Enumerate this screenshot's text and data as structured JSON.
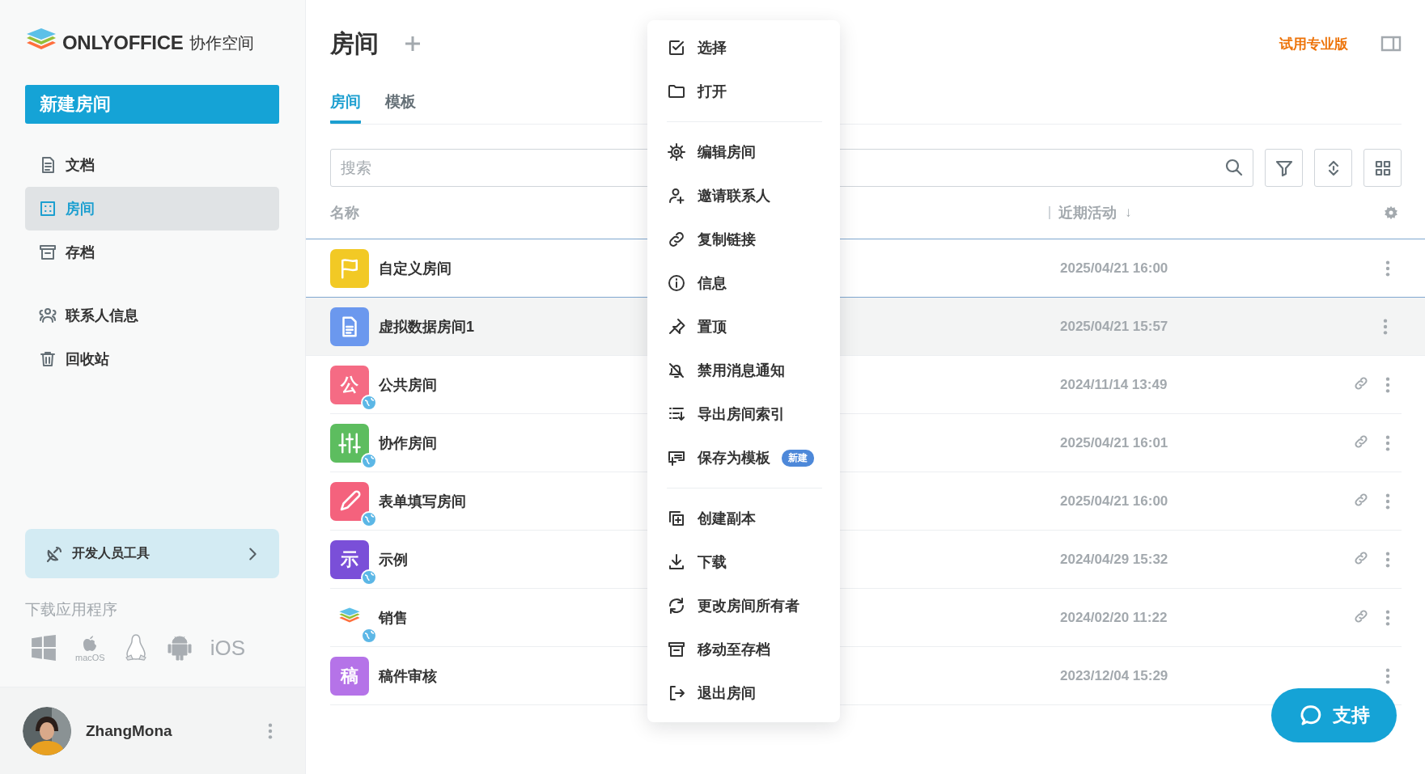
{
  "logo": {
    "brand": "ONLYOFFICE",
    "product": "协作空间"
  },
  "sidebar": {
    "new_button": "新建房间",
    "sections": [
      {
        "items": [
          {
            "label": "文档",
            "selected": false
          },
          {
            "label": "房间",
            "selected": true
          },
          {
            "label": "存档",
            "selected": false
          }
        ]
      },
      {
        "items": [
          {
            "label": "联系人信息",
            "selected": false
          },
          {
            "label": "回收站",
            "selected": false
          }
        ]
      }
    ],
    "dev_tools": "开发人员工具",
    "download_label": "下载应用程序",
    "apps": [
      {
        "kind": "windows"
      },
      {
        "kind": "macos",
        "label": "macOS"
      },
      {
        "kind": "linux"
      },
      {
        "kind": "android"
      },
      {
        "kind": "ios",
        "label": "iOS"
      }
    ],
    "user": {
      "name": "ZhangMona"
    }
  },
  "header": {
    "title": "房间",
    "trial": "试用专业版"
  },
  "tabs": [
    {
      "label": "房间",
      "selected": true
    },
    {
      "label": "模板",
      "selected": false
    }
  ],
  "search": {
    "placeholder": "搜索"
  },
  "table": {
    "columns": [
      {
        "label": "名称"
      },
      {
        "label": "近期活动",
        "sort": "↓"
      }
    ],
    "rows": [
      {
        "name": "自定义房间",
        "date": "2025/04/21 16:00",
        "icon": {
          "kind": "flag",
          "color": "#f2c925"
        },
        "public": false,
        "link": false,
        "selected": false
      },
      {
        "name": "虚拟数据房间1",
        "date": "2025/04/21 15:57",
        "icon": {
          "kind": "document",
          "color": "#6b98ee"
        },
        "public": false,
        "link": false,
        "selected": true
      },
      {
        "name": "公共房间",
        "date": "2024/11/14 13:49",
        "icon": {
          "kind": "letter",
          "color": "#f56b84",
          "letter": "公"
        },
        "public": true,
        "link": true,
        "selected": false
      },
      {
        "name": "协作房间",
        "date": "2025/04/21 16:01",
        "icon": {
          "kind": "sliders",
          "color": "#5dbd5f"
        },
        "public": true,
        "link": true,
        "selected": false
      },
      {
        "name": "表单填写房间",
        "date": "2025/04/21 16:00",
        "icon": {
          "kind": "pencil",
          "color": "#f4627d"
        },
        "public": true,
        "link": true,
        "selected": false
      },
      {
        "name": "示例",
        "date": "2024/04/29 15:32",
        "icon": {
          "kind": "letter",
          "color": "#7a4fd8",
          "letter": "示"
        },
        "public": true,
        "link": true,
        "selected": false
      },
      {
        "name": "销售",
        "date": "2024/02/20 11:22",
        "icon": {
          "kind": "logo"
        },
        "public": true,
        "link": true,
        "selected": false
      },
      {
        "name": "稿件审核",
        "date": "2023/12/04 15:29",
        "icon": {
          "kind": "letter",
          "color": "#b573e8",
          "letter": "稿"
        },
        "public": false,
        "link": false,
        "selected": false
      }
    ]
  },
  "context_menu": {
    "sections": [
      {
        "items": [
          {
            "label": "选择"
          },
          {
            "label": "打开"
          }
        ]
      },
      {
        "items": [
          {
            "label": "编辑房间"
          },
          {
            "label": "邀请联系人"
          },
          {
            "label": "复制链接"
          },
          {
            "label": "信息"
          },
          {
            "label": "置顶"
          },
          {
            "label": "禁用消息通知"
          },
          {
            "label": "导出房间索引"
          },
          {
            "label": "保存为模板",
            "badge": "新建"
          }
        ]
      },
      {
        "items": [
          {
            "label": "创建副本"
          },
          {
            "label": "下载"
          },
          {
            "label": "更改房间所有者"
          },
          {
            "label": "移动至存档"
          },
          {
            "label": "退出房间"
          }
        ]
      }
    ]
  },
  "support_button": "支持"
}
